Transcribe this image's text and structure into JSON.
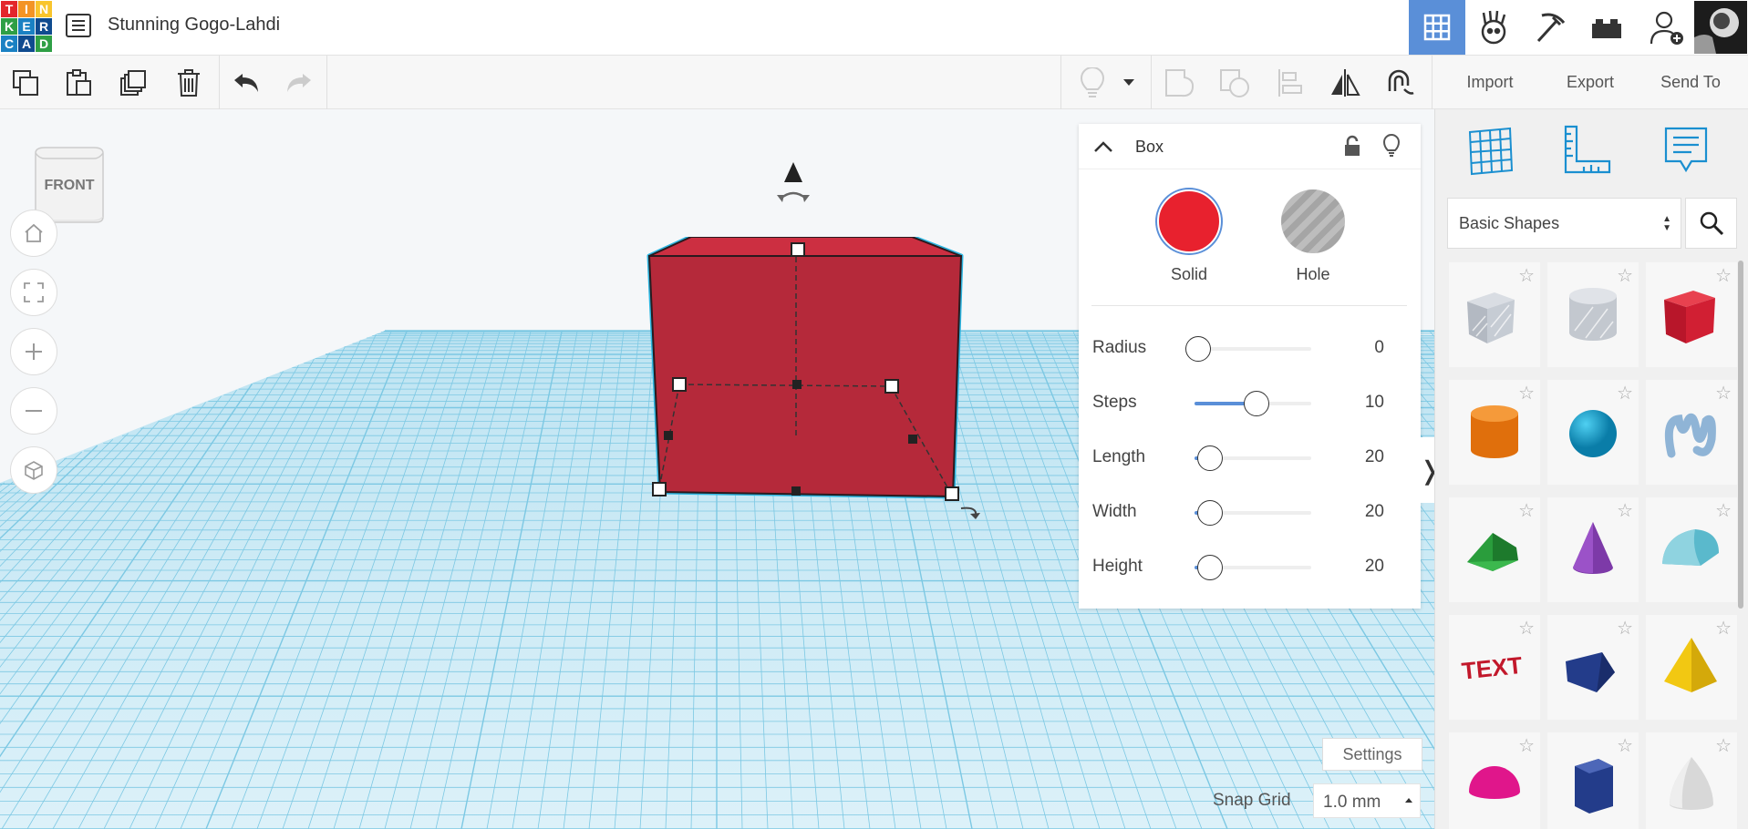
{
  "app": {
    "logo_letters": [
      "T",
      "I",
      "N",
      "K",
      "E",
      "R",
      "C",
      "A",
      "D"
    ],
    "logo_colors": [
      "#e3262c",
      "#f39425",
      "#f9c52d",
      "#2e9f45",
      "#1a81c3",
      "#0f4b8f",
      "#1a81c3",
      "#0f4b8f",
      "#2e9f45"
    ],
    "design_title": "Stunning Gogo-Lahdi"
  },
  "header": {
    "buttons": [
      {
        "name": "grid-view-icon",
        "active": true
      },
      {
        "name": "blocks-robot-icon",
        "active": false
      },
      {
        "name": "pickaxe-icon",
        "active": false
      },
      {
        "name": "bricks-icon",
        "active": false
      },
      {
        "name": "add-user-icon",
        "active": false
      },
      {
        "name": "avatar",
        "active": false
      }
    ]
  },
  "toolbar": {
    "left_icons": [
      "copy-icon",
      "paste-icon",
      "duplicate-icon",
      "delete-icon",
      "undo-icon",
      "redo-icon"
    ],
    "right_icons": [
      "light-bulb-icon",
      "dropdown-caret-icon",
      "group-icon",
      "ungroup-icon",
      "align-icon",
      "mirror-icon",
      "cruise-magnet-icon"
    ],
    "import_label": "Import",
    "export_label": "Export",
    "send_to_label": "Send To"
  },
  "viewcube": {
    "face_label": "FRONT"
  },
  "nav_buttons": [
    "home-view-icon",
    "fit-view-icon",
    "zoom-in-icon",
    "zoom-out-icon",
    "perspective-icon"
  ],
  "inspector": {
    "title": "Box",
    "solid_label": "Solid",
    "hole_label": "Hole",
    "solid_color": "#e8212e",
    "properties": [
      {
        "label": "Radius",
        "value": "0",
        "fraction": 0.0
      },
      {
        "label": "Steps",
        "value": "10",
        "fraction": 0.5
      },
      {
        "label": "Length",
        "value": "20",
        "fraction": 0.1
      },
      {
        "label": "Width",
        "value": "20",
        "fraction": 0.1
      },
      {
        "label": "Height",
        "value": "20",
        "fraction": 0.1
      }
    ]
  },
  "workplane": {
    "settings_label": "Settings",
    "snap_grid_label": "Snap Grid",
    "snap_grid_value": "1.0 mm",
    "collapse_glyph": "❭",
    "selected_color": "#b5293a",
    "outline_color": "#2bb5e0"
  },
  "shapes_panel": {
    "top_icons": [
      "workplane-icon",
      "ruler-icon",
      "notes-icon"
    ],
    "category_value": "Basic Shapes",
    "shapes": [
      {
        "name": "box-hole-shape"
      },
      {
        "name": "cylinder-hole-shape"
      },
      {
        "name": "box-shape"
      },
      {
        "name": "cylinder-shape"
      },
      {
        "name": "sphere-shape"
      },
      {
        "name": "scribble-shape"
      },
      {
        "name": "roof-shape"
      },
      {
        "name": "cone-shape"
      },
      {
        "name": "round-roof-shape"
      },
      {
        "name": "text-shape"
      },
      {
        "name": "wedge-shape"
      },
      {
        "name": "pyramid-shape"
      },
      {
        "name": "half-sphere-shape"
      },
      {
        "name": "polygon-shape"
      },
      {
        "name": "paraboloid-shape"
      }
    ]
  }
}
